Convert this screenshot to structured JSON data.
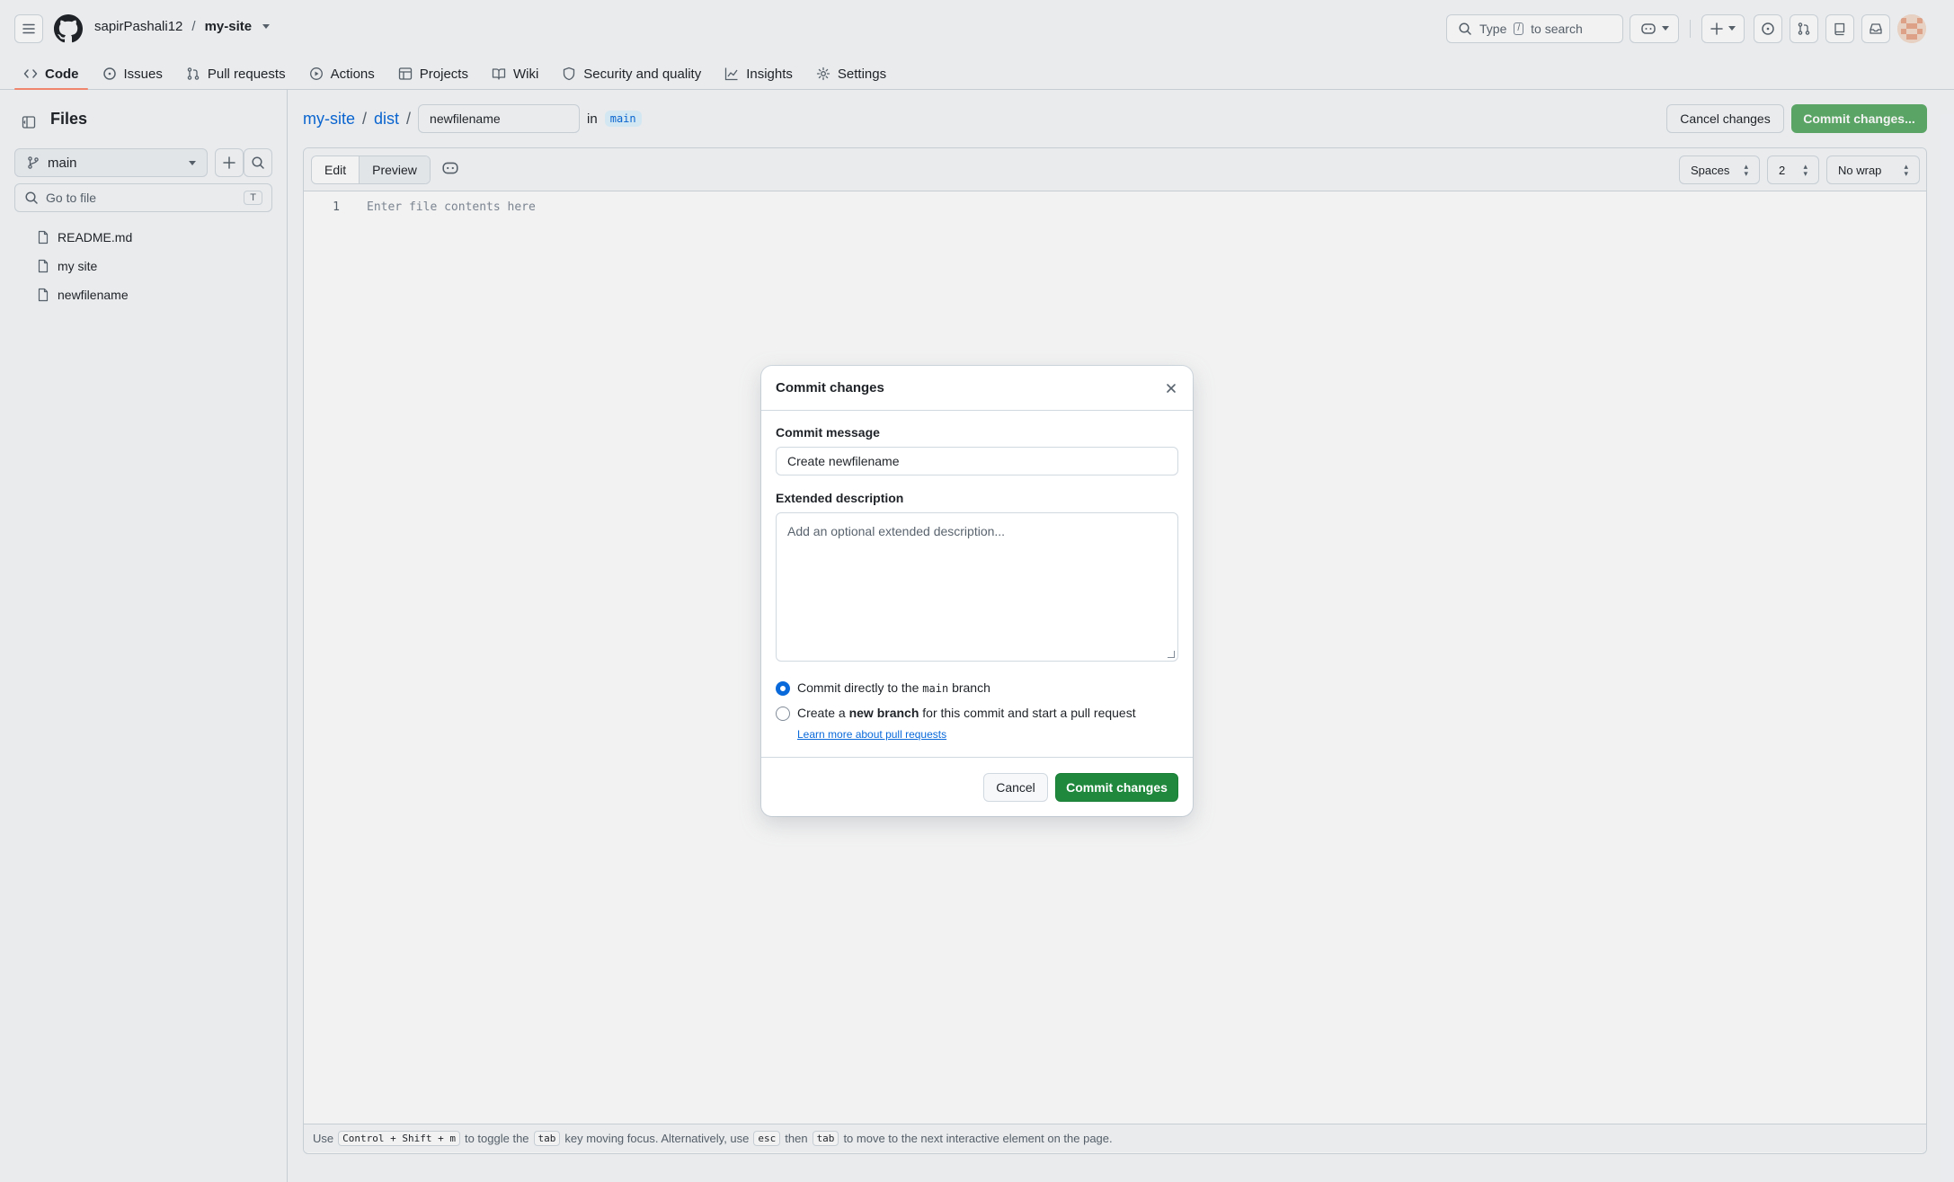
{
  "header": {
    "owner": "sapirPashali12",
    "separator": "/",
    "repo": "my-site",
    "search": {
      "prefix": "Type",
      "key": "/",
      "suffix": "to search"
    }
  },
  "tabs": [
    {
      "label": "Code",
      "icon": "code-icon",
      "active": true
    },
    {
      "label": "Issues",
      "icon": "issue-opened-icon"
    },
    {
      "label": "Pull requests",
      "icon": "git-pull-request-icon"
    },
    {
      "label": "Actions",
      "icon": "play-icon"
    },
    {
      "label": "Projects",
      "icon": "table-icon"
    },
    {
      "label": "Wiki",
      "icon": "book-icon"
    },
    {
      "label": "Security and quality",
      "icon": "shield-icon"
    },
    {
      "label": "Insights",
      "icon": "graph-icon"
    },
    {
      "label": "Settings",
      "icon": "gear-icon"
    }
  ],
  "sidebar": {
    "title": "Files",
    "branch": "main",
    "goto_placeholder": "Go to file",
    "goto_shortcut": "T",
    "files": [
      "README.md",
      "my site",
      "newfilename"
    ]
  },
  "editor_header": {
    "path_root": "my-site",
    "path_dir": "dist",
    "slash": "/",
    "filename": "newfilename",
    "in_label": "in",
    "branch": "main",
    "cancel_label": "Cancel changes",
    "commit_label": "Commit changes..."
  },
  "editor": {
    "edit_tab": "Edit",
    "preview_tab": "Preview",
    "indent_mode": "Spaces",
    "indent_size": "2",
    "wrap_mode": "No wrap",
    "line_number": "1",
    "placeholder": "Enter file contents here",
    "footer": {
      "use": "Use",
      "shortcut": "Control + Shift + m",
      "toggle_text": "to toggle the",
      "tab_key": "tab",
      "focus_text": "key moving focus. Alternatively, use",
      "esc_key": "esc",
      "then": "then",
      "tab_key2": "tab",
      "end_text": "to move to the next interactive element on the page."
    }
  },
  "dialog": {
    "title": "Commit changes",
    "message_label": "Commit message",
    "message_value": "Create newfilename",
    "description_label": "Extended description",
    "description_placeholder": "Add an optional extended description...",
    "option_direct": {
      "prefix": "Commit directly to the",
      "branch": "main",
      "suffix": "branch",
      "checked": true
    },
    "option_new": {
      "prefix": "Create a",
      "bold": "new branch",
      "suffix": "for this commit and start a pull request",
      "checked": false
    },
    "learn_more": "Learn more about pull requests",
    "cancel_label": "Cancel",
    "commit_label": "Commit changes"
  },
  "colors": {
    "accent": "#0969da",
    "primary_button": "#1f883d",
    "primary_button_disabled": "#5eae6a",
    "tab_underline": "#fd8c73"
  }
}
